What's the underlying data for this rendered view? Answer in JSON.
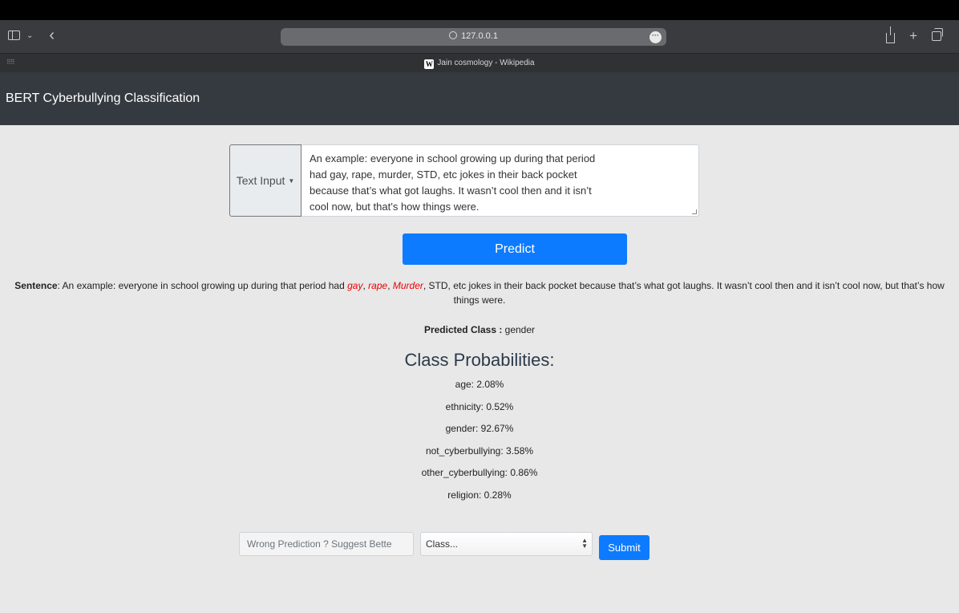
{
  "browser": {
    "url": "127.0.0.1",
    "tab_title": "Jain cosmology - Wikipedia",
    "wiki_logo_letter": "W"
  },
  "app": {
    "brand": "BERT Cyberbullying Classification"
  },
  "input": {
    "label": "Text Input",
    "text": "An example: everyone in school growing up during that period had gay, rape, murder, STD, etc jokes in their back pocket because that’s what got laughs. It wasn’t cool then and it isn’t cool now, but that’s how things were."
  },
  "predict_label": "Predict",
  "sentence": {
    "label": "Sentence",
    "part1": ": An example: everyone in school growing up during that period had ",
    "hl1": "gay",
    "sep1": ", ",
    "hl2": "rape",
    "sep2": ", ",
    "hl3": "Murder",
    "part2": ", STD, etc jokes in their back pocket because that’s what got laughs. It wasn’t cool then and it isn’t cool now, but that’s how things were."
  },
  "prediction": {
    "label": "Predicted Class :",
    "value": " gender"
  },
  "probabilities": {
    "title": "Class Probabilities:",
    "items": [
      "age: 2.08%",
      "ethnicity: 0.52%",
      "gender: 92.67%",
      "not_cyberbullying: 3.58%",
      "other_cyberbullying: 0.86%",
      "religion: 0.28%"
    ]
  },
  "feedback": {
    "placeholder": "Wrong Prediction ? Suggest Bette",
    "select_value": "Class...",
    "submit_label": "Submit"
  }
}
